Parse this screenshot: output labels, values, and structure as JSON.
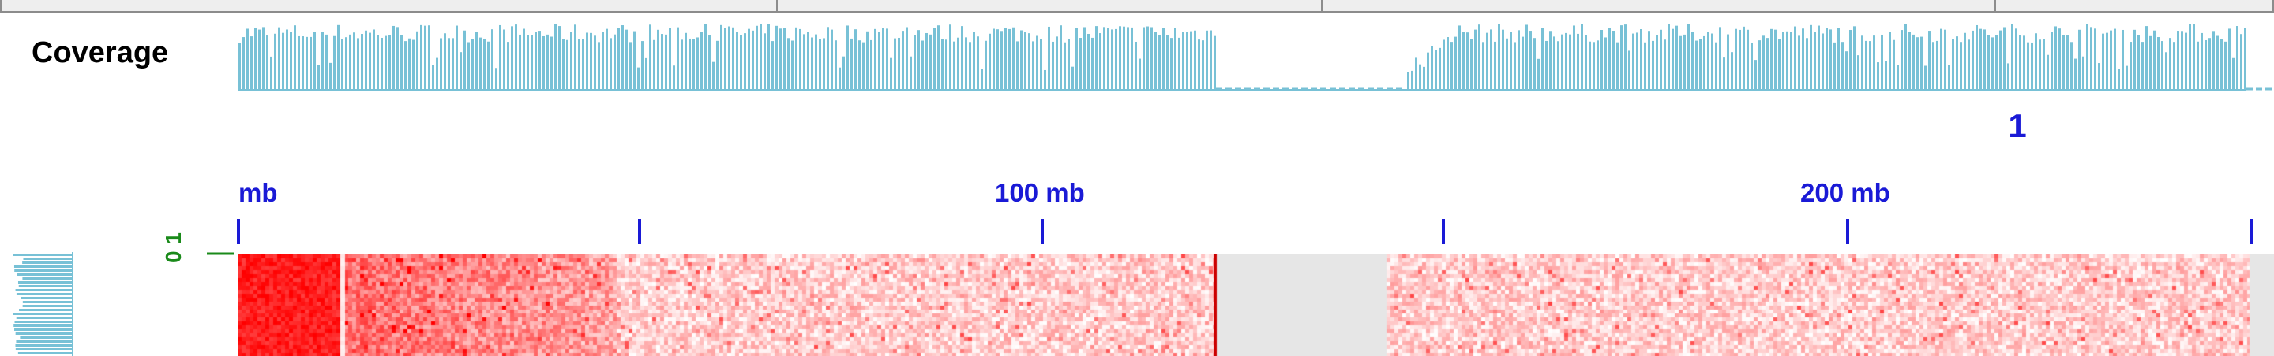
{
  "coverage_track": {
    "label": "Coverage",
    "color": "#78c1d6",
    "gap_color": "#78c1d6"
  },
  "chromosome": {
    "label": "1"
  },
  "ruler": {
    "color": "#1a1ad6",
    "labels": [
      "mb",
      "100 mb",
      "200 mb"
    ]
  },
  "side_scale": {
    "label": "0 1",
    "color": "#1a8a1a"
  },
  "heatmap": {
    "colors": {
      "high": "#ff0000",
      "low": "#ffffff",
      "no_data": "#e6e6e6"
    },
    "centromere_marker_color": "#cc0000"
  }
}
